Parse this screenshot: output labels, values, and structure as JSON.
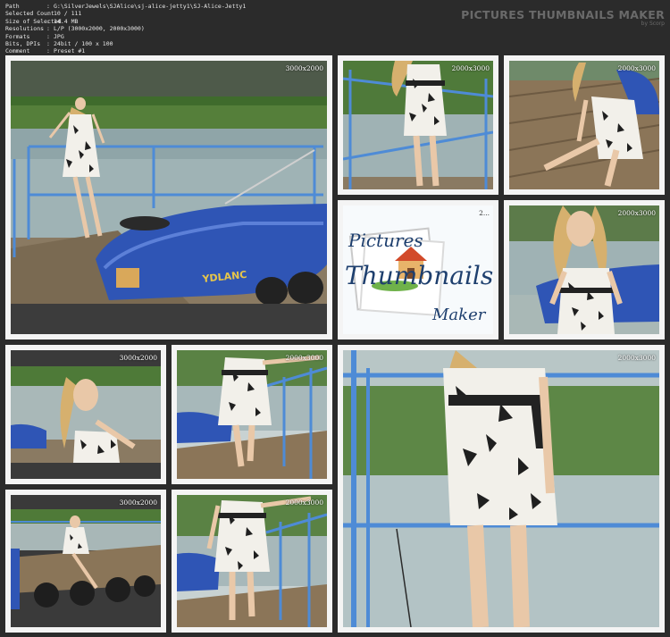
{
  "info": {
    "rows": [
      {
        "key": "Path",
        "value": "G:\\SilverJewels\\SJAlice\\sj-alice-jetty1\\SJ-Alice-Jetty1"
      },
      {
        "key": "Selected Count",
        "value": "10 / 111"
      },
      {
        "key": "Size of Selected",
        "value": "14.4 MB"
      },
      {
        "key": "Resolutions",
        "value": "L/P (3000x2000, 2000x3000)"
      },
      {
        "key": "Formats",
        "value": "JPG"
      },
      {
        "key": "Bits, DPIs",
        "value": "24bit / 100 x 100"
      },
      {
        "key": "Comment",
        "value": "Preset #1"
      }
    ],
    "separator": ":"
  },
  "brand": {
    "title": "PICTURES THUMBNAILS MAKER",
    "subtitle": "by Scorp"
  },
  "thumbnails": [
    {
      "res": "3000x2000"
    },
    {
      "res": "2000x3000"
    },
    {
      "res": "2000x3000"
    },
    {
      "res": "2..."
    },
    {
      "res": "2000x3000"
    },
    {
      "res": "3000x2000"
    },
    {
      "res": "2000x3000"
    },
    {
      "res": "2000x3000"
    },
    {
      "res": "3000x2000"
    },
    {
      "res": "2000x3000"
    }
  ],
  "logo": {
    "line1": "Pictures",
    "line2": "Thumbnails",
    "line3": "Maker"
  },
  "boat_text": "YDLANC"
}
